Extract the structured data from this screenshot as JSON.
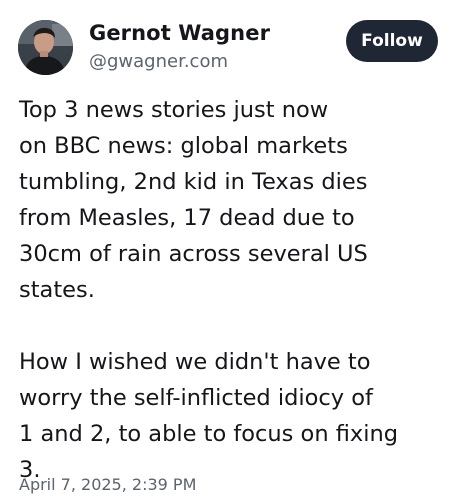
{
  "author": {
    "name": "Gernot Wagner",
    "handle": "@gwagner.com",
    "avatar_icon": "profile-photo"
  },
  "follow_button": {
    "label": "Follow",
    "bg_color": "#1f2735"
  },
  "post": {
    "paragraph1": [
      "Top 3 news stories just now",
      "on BBC news: global markets",
      "tumbling, 2nd kid in Texas dies",
      "from Measles, 17 dead due to",
      "30cm of rain across several US",
      "states."
    ],
    "paragraph2": [
      "How I wished we didn't have to",
      "worry the self-inflicted idiocy of",
      "1 and 2, to able to focus on fixing",
      "3."
    ],
    "timestamp": "April 7, 2025, 2:39 PM"
  }
}
